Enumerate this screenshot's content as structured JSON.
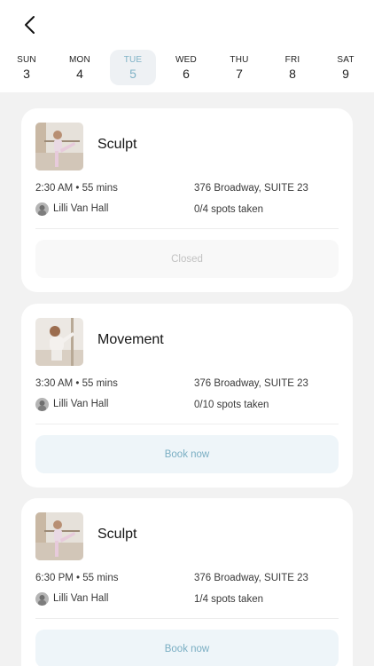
{
  "nav": {
    "back_icon": "chevron-left-icon"
  },
  "days": [
    {
      "name": "SUN",
      "num": "3",
      "active": false
    },
    {
      "name": "MON",
      "num": "4",
      "active": false
    },
    {
      "name": "TUE",
      "num": "5",
      "active": true
    },
    {
      "name": "WED",
      "num": "6",
      "active": false
    },
    {
      "name": "THU",
      "num": "7",
      "active": false
    },
    {
      "name": "FRI",
      "num": "8",
      "active": false
    },
    {
      "name": "SAT",
      "num": "9",
      "active": false
    }
  ],
  "classes": [
    {
      "title": "Sculpt",
      "time": "2:30 AM • 55 mins",
      "address": "376 Broadway, SUITE 23",
      "instructor": "Lilli Van Hall",
      "spots": "0/4 spots taken",
      "action": "Closed",
      "action_state": "closed"
    },
    {
      "title": "Movement",
      "time": "3:30 AM • 55 mins",
      "address": "376 Broadway, SUITE 23",
      "instructor": "Lilli Van Hall",
      "spots": "0/10 spots taken",
      "action": "Book now",
      "action_state": "open"
    },
    {
      "title": "Sculpt",
      "time": "6:30 PM • 55 mins",
      "address": "376 Broadway, SUITE 23",
      "instructor": "Lilli Van Hall",
      "spots": "1/4 spots taken",
      "action": "Book now",
      "action_state": "open"
    }
  ],
  "colors": {
    "accent": "#7fb2c6",
    "book_bg": "#eef5f9",
    "closed_bg": "#f8f8f8",
    "page_bg": "#f2f2f2"
  }
}
